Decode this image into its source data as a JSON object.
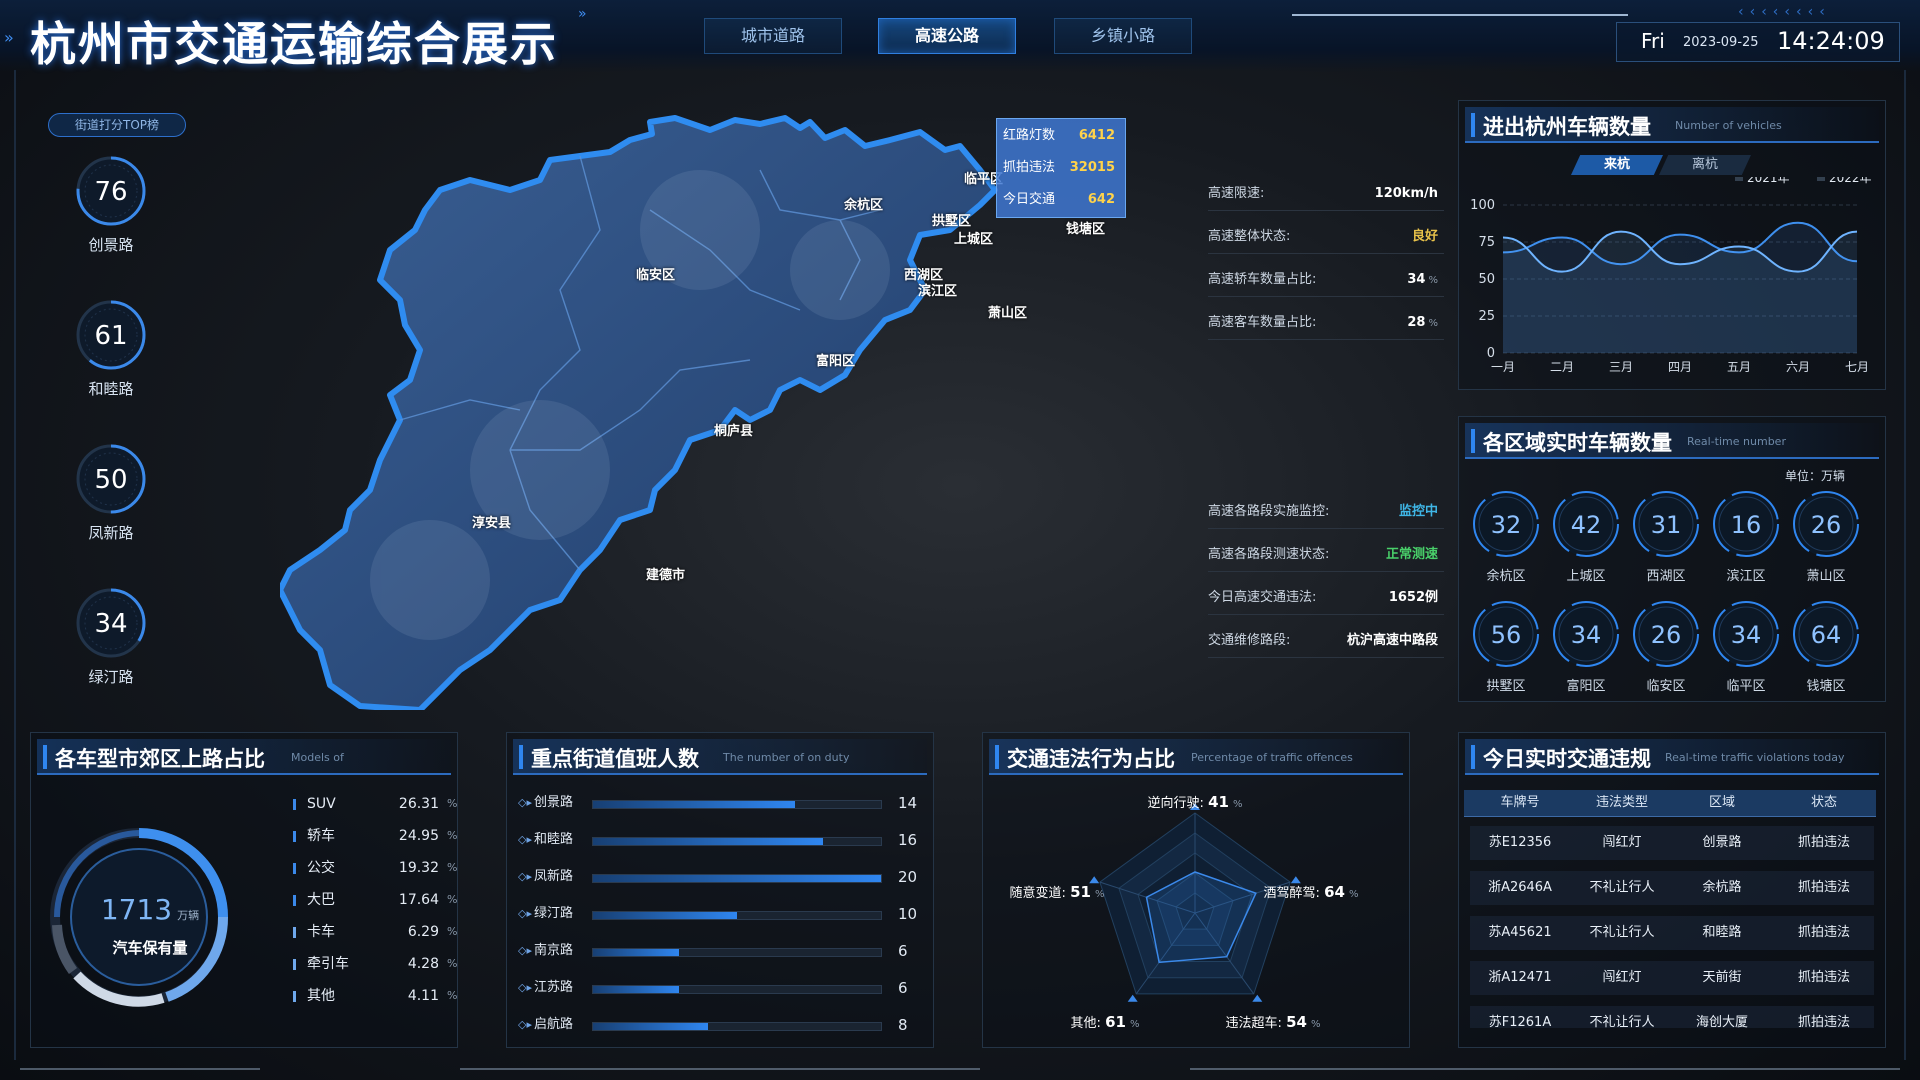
{
  "header": {
    "title": "杭州市交通运输综合展示",
    "tabs": [
      "城市道路",
      "高速公路",
      "乡镇小路"
    ],
    "active_tab": 1,
    "day": "Fri",
    "date": "2023-09-25",
    "time": "14:24:09"
  },
  "ranking": {
    "tag": "街道打分TOP榜",
    "items": [
      {
        "value": "76",
        "label": "创景路",
        "fraction": 0.76
      },
      {
        "value": "61",
        "label": "和睦路",
        "fraction": 0.61
      },
      {
        "value": "50",
        "label": "凤新路",
        "fraction": 0.5
      },
      {
        "value": "34",
        "label": "绿汀路",
        "fraction": 0.34
      }
    ]
  },
  "map": {
    "districts": [
      "余杭区",
      "临平区",
      "拱墅区",
      "上城区",
      "钱塘区",
      "临安区",
      "西湖区",
      "滨江区",
      "萧山区",
      "富阳区",
      "桐庐县",
      "淳安县",
      "建德市"
    ],
    "tooltip": [
      {
        "label": "红路灯数",
        "value": "6412"
      },
      {
        "label": "抓拍违法",
        "value": "32015"
      },
      {
        "label": "今日交通",
        "value": "642"
      }
    ]
  },
  "info_top": [
    {
      "label": "高速限速:",
      "value": "120km/h",
      "unit": "",
      "color": "#ffffff"
    },
    {
      "label": "高速整体状态:",
      "value": "良好",
      "unit": "",
      "color": "#e8c24a"
    },
    {
      "label": "高速轿车数量占比:",
      "value": "34",
      "unit": "%",
      "color": "#ffffff"
    },
    {
      "label": "高速客车数量占比:",
      "value": "28",
      "unit": "%",
      "color": "#ffffff"
    }
  ],
  "info_bottom": [
    {
      "label": "高速各路段实施监控:",
      "value": "监控中",
      "unit": "",
      "color": "#3fb6e6"
    },
    {
      "label": "高速各路段测速状态:",
      "value": "正常测速",
      "unit": "",
      "color": "#49d06a"
    },
    {
      "label": "今日高速交通违法:",
      "value": "1652例",
      "unit": "",
      "color": "#ffffff"
    },
    {
      "label": "交通维修路段:",
      "value": "杭沪高速中路段",
      "unit": "",
      "color": "#ffffff"
    }
  ],
  "vehicles_panel": {
    "title": "进出杭州车辆数量",
    "subtitle": "Number of vehicles",
    "toggle": [
      "来杭",
      "离杭"
    ],
    "active_toggle": 0
  },
  "chart_data": {
    "type": "line",
    "categories": [
      "一月",
      "二月",
      "三月",
      "四月",
      "五月",
      "六月",
      "七月"
    ],
    "series": [
      {
        "name": "2021年",
        "values": [
          68,
          78,
          60,
          80,
          68,
          88,
          62
        ]
      },
      {
        "name": "2022年",
        "values": [
          78,
          55,
          82,
          60,
          72,
          55,
          82
        ]
      }
    ],
    "ylim": [
      0,
      100
    ],
    "yticks": [
      0,
      25,
      50,
      75,
      100
    ],
    "legend": "top-right",
    "colors": [
      "#3e8fee",
      "#6fb4ff"
    ]
  },
  "region_panel": {
    "title": "各区域实时车辆数量",
    "subtitle": "Real-time number",
    "unit": "单位：万辆",
    "items": [
      {
        "value": "32",
        "label": "余杭区"
      },
      {
        "value": "42",
        "label": "上城区"
      },
      {
        "value": "31",
        "label": "西湖区"
      },
      {
        "value": "16",
        "label": "滨江区"
      },
      {
        "value": "26",
        "label": "萧山区"
      },
      {
        "value": "56",
        "label": "拱墅区"
      },
      {
        "value": "34",
        "label": "富阳区"
      },
      {
        "value": "26",
        "label": "临安区"
      },
      {
        "value": "34",
        "label": "临平区"
      },
      {
        "value": "64",
        "label": "钱塘区"
      }
    ]
  },
  "models_panel": {
    "title": "各车型市郊区上路占比",
    "subtitle": "Models of",
    "total": "1713",
    "total_unit": "万辆",
    "total_label": "汽车保有量",
    "shares": [
      {
        "name": "SUV",
        "pct": "26.31",
        "unit": "%"
      },
      {
        "name": "轿车",
        "pct": "24.95",
        "unit": "%"
      },
      {
        "name": "公交",
        "pct": "19.32",
        "unit": "%"
      },
      {
        "name": "大巴",
        "pct": "17.64",
        "unit": "%"
      },
      {
        "name": "卡车",
        "pct": "6.29",
        "unit": "%"
      },
      {
        "name": "牵引车",
        "pct": "4.28",
        "unit": "%"
      },
      {
        "name": "其他",
        "pct": "4.11",
        "unit": "%"
      }
    ]
  },
  "duty_panel": {
    "title": "重点街道值班人数",
    "subtitle": "The number of on duty",
    "max": 20,
    "rows": [
      {
        "name": "创景路",
        "value": 14
      },
      {
        "name": "和睦路",
        "value": 16
      },
      {
        "name": "凤新路",
        "value": 20
      },
      {
        "name": "绿汀路",
        "value": 10
      },
      {
        "name": "南京路",
        "value": 6
      },
      {
        "name": "江苏路",
        "value": 6
      },
      {
        "name": "启航路",
        "value": 8
      }
    ]
  },
  "offence_panel": {
    "title": "交通违法行为占比",
    "subtitle": "Percentage of traffic offences",
    "radar": [
      {
        "name": "逆向行驶:",
        "value": 41,
        "unit": "%"
      },
      {
        "name": "酒驾醉驾:",
        "value": 64,
        "unit": "%"
      },
      {
        "name": "违法超车:",
        "value": 54,
        "unit": "%"
      },
      {
        "name": "其他:",
        "value": 61,
        "unit": "%"
      },
      {
        "name": "随意变道:",
        "value": 51,
        "unit": "%"
      }
    ]
  },
  "violations_panel": {
    "title": "今日实时交通违规",
    "subtitle": "Real-time traffic violations today",
    "columns": [
      "车牌号",
      "违法类型",
      "区域",
      "状态"
    ],
    "rows": [
      [
        "苏E12356",
        "闯红灯",
        "创景路",
        "抓拍违法"
      ],
      [
        "浙A2646A",
        "不礼让行人",
        "余杭路",
        "抓拍违法"
      ],
      [
        "苏A45621",
        "不礼让行人",
        "和睦路",
        "抓拍违法"
      ],
      [
        "浙A12471",
        "闯红灯",
        "天前街",
        "抓拍违法"
      ],
      [
        "苏F1261A",
        "不礼让行人",
        "海创大厦",
        "抓拍违法"
      ]
    ]
  }
}
